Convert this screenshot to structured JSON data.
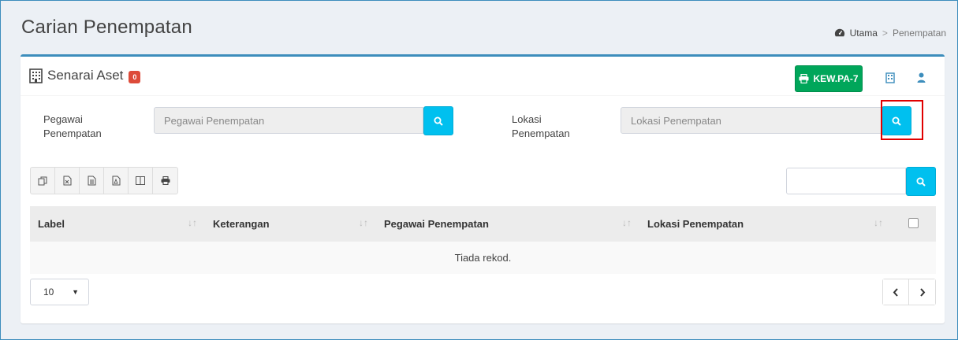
{
  "page": {
    "title": "Carian Penempatan"
  },
  "breadcrumb": {
    "home": "Utama",
    "separator": ">",
    "current": "Penempatan"
  },
  "box": {
    "title": "Senarai Aset",
    "badge": "0",
    "print_button": "KEW.PA-7"
  },
  "filters": {
    "pegawai": {
      "label_line1": "Pegawai",
      "label_line2": "Penempatan",
      "placeholder": "Pegawai Penempatan",
      "value": ""
    },
    "lokasi": {
      "label_line1": "Lokasi",
      "label_line2": "Penempatan",
      "placeholder": "Lokasi Penempatan",
      "value": ""
    }
  },
  "toolbar": {
    "buttons": [
      "copy-icon",
      "excel-icon",
      "csv-icon",
      "pdf-icon",
      "columns-icon",
      "print-icon"
    ]
  },
  "table": {
    "columns": [
      "Label",
      "Keterangan",
      "Pegawai Penempatan",
      "Lokasi Penempatan"
    ],
    "empty_message": "Tiada rekod."
  },
  "pagination": {
    "page_size": "10",
    "prev": "‹",
    "next": "›"
  },
  "colors": {
    "accent": "#3c8dbc",
    "success": "#00a65a",
    "info": "#00c0ef",
    "danger": "#dd4b39",
    "highlight": "#e00000"
  }
}
